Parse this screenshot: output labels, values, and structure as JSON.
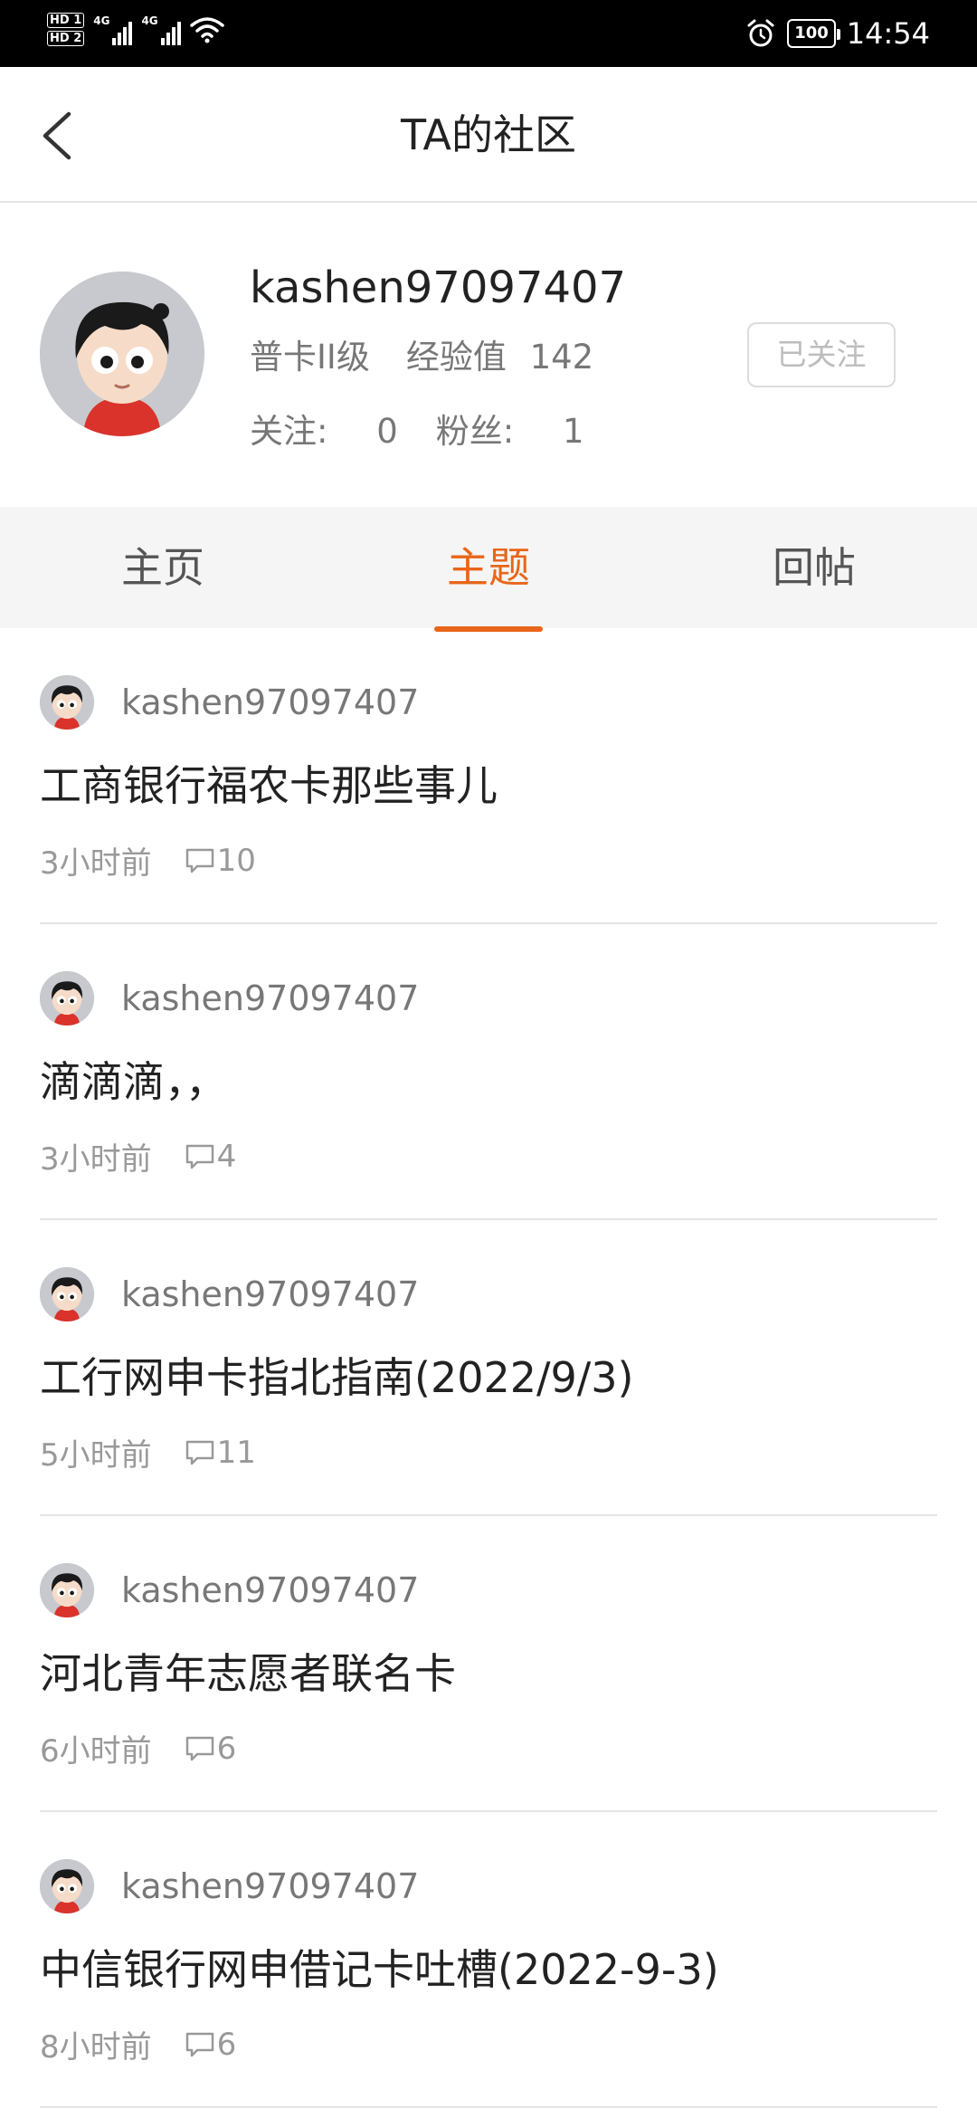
{
  "status_bar": {
    "hd1": "HD 1",
    "hd2": "HD 2",
    "sig1": "4G",
    "sig2": "4G",
    "battery": "100",
    "time": "14:54"
  },
  "nav": {
    "title": "TA的社区"
  },
  "profile": {
    "username": "kashen97097407",
    "level": "普卡II级",
    "exp_label": "经验值",
    "exp_value": "142",
    "following_label": "关注:",
    "following_value": "0",
    "fans_label": "粉丝:",
    "fans_value": "1",
    "follow_button": "已关注"
  },
  "tabs": [
    {
      "label": "主页",
      "active": false
    },
    {
      "label": "主题",
      "active": true
    },
    {
      "label": "回帖",
      "active": false
    }
  ],
  "colors": {
    "accent": "#e8661a"
  },
  "posts": [
    {
      "user": "kashen97097407",
      "title": "工商银行福农卡那些事儿",
      "time": "3小时前",
      "comments": "10"
    },
    {
      "user": "kashen97097407",
      "title": "滴滴滴，，",
      "time": "3小时前",
      "comments": "4"
    },
    {
      "user": "kashen97097407",
      "title": "工行网申卡指北指南(2022/9/3)",
      "time": "5小时前",
      "comments": "11"
    },
    {
      "user": "kashen97097407",
      "title": "河北青年志愿者联名卡",
      "time": "6小时前",
      "comments": "6"
    },
    {
      "user": "kashen97097407",
      "title": "中信银行网申借记卡吐槽(2022-9-3)",
      "time": "8小时前",
      "comments": "6"
    }
  ]
}
